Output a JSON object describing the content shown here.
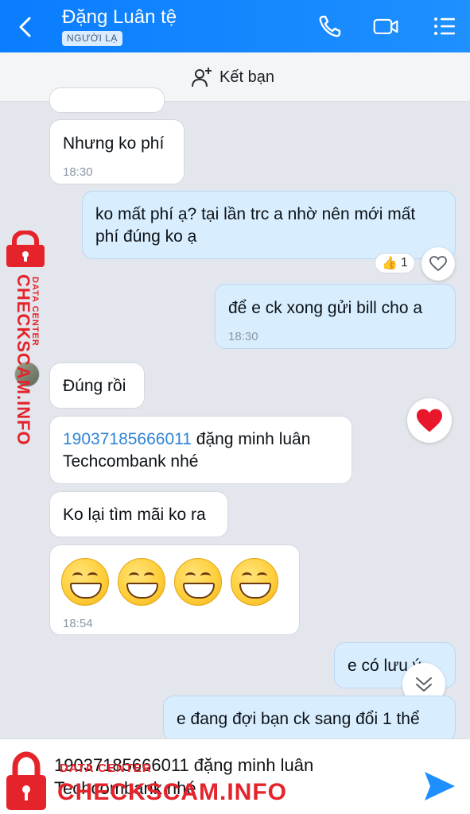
{
  "header": {
    "title": "Đặng Luân tệ",
    "badge": "NGƯỜI LẠ",
    "icons": [
      "back-icon",
      "phone-icon",
      "video-call-icon",
      "menu-icon"
    ]
  },
  "friend_bar": {
    "label": "Kết bạn",
    "icon": "add-friend-icon"
  },
  "messages": [
    {
      "dir": "in",
      "text": "Nhưng ko phí",
      "time": "18:30"
    },
    {
      "dir": "out",
      "text_line1": "ko mất phí ạ? tại lần trc a nhờ nên mới mất",
      "text_line2": "phí đúng ko ạ",
      "reaction": "👍",
      "reaction_count": "1"
    },
    {
      "dir": "out",
      "text": "để e ck xong gửi bill cho a",
      "time": "18:30"
    },
    {
      "dir": "in",
      "text": "Đúng rồi"
    },
    {
      "dir": "in",
      "link": "19037185666011",
      "text_rest": " đặng minh luân",
      "text_line2": "Techcombank nhé"
    },
    {
      "dir": "in",
      "text": "Ko lại tìm mãi ko ra"
    },
    {
      "dir": "in",
      "emoji_count": 4,
      "time": "18:54"
    },
    {
      "dir": "out",
      "text": "e có lưu ý"
    },
    {
      "dir": "out",
      "text": "e đang đợi bạn ck sang đổi 1 thể"
    }
  ],
  "input": {
    "line1": "19037185666011 đặng minh luân",
    "line2": "Techcombank nhé"
  },
  "watermark": {
    "sub": "DATA CENTER",
    "main": "CHECKSCAM.INFO"
  },
  "colors": {
    "header": "#0a7dff",
    "outgoing_bubble": "#d8eeff",
    "incoming_bubble": "#ffffff",
    "watermark": "#e5232b",
    "send": "#1e8fff"
  }
}
